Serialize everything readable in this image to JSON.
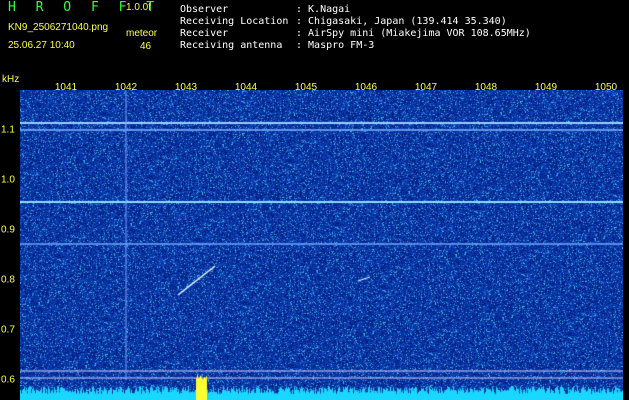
{
  "header": {
    "logo": "H R O F F T",
    "version": "1.0.0f",
    "filename": "KN9_2506271040.png",
    "datetime": "25.06.27 10:40",
    "meteor_label": "meteor",
    "meteor_count": "46",
    "info": [
      {
        "label": "Observer",
        "value": ": K.Nagai"
      },
      {
        "label": "Receiving Location",
        "value": ": Chigasaki, Japan (139.414 35.340)"
      },
      {
        "label": "Receiver",
        "value": ": AirSpy mini (Miakejima VOR 108.65MHz)"
      },
      {
        "label": "Receiving antenna",
        "value": ": Maspro FM-3"
      }
    ]
  },
  "axis": {
    "unit": "kHz",
    "x_ticks": [
      "1041",
      "1042",
      "1043",
      "1044",
      "1045",
      "1046",
      "1047",
      "1048",
      "1049",
      "1050"
    ],
    "y_ticks": [
      "1.1",
      "1.0",
      "0.9",
      "0.8",
      "0.7",
      "0.6"
    ]
  },
  "colors": {
    "background": "#000000",
    "plot_bg": "#06207f",
    "label": "#ffff4a",
    "logo": "#35ff35",
    "tone_line": "#5aa0ff",
    "spectrum": "#1ad7ff"
  }
}
